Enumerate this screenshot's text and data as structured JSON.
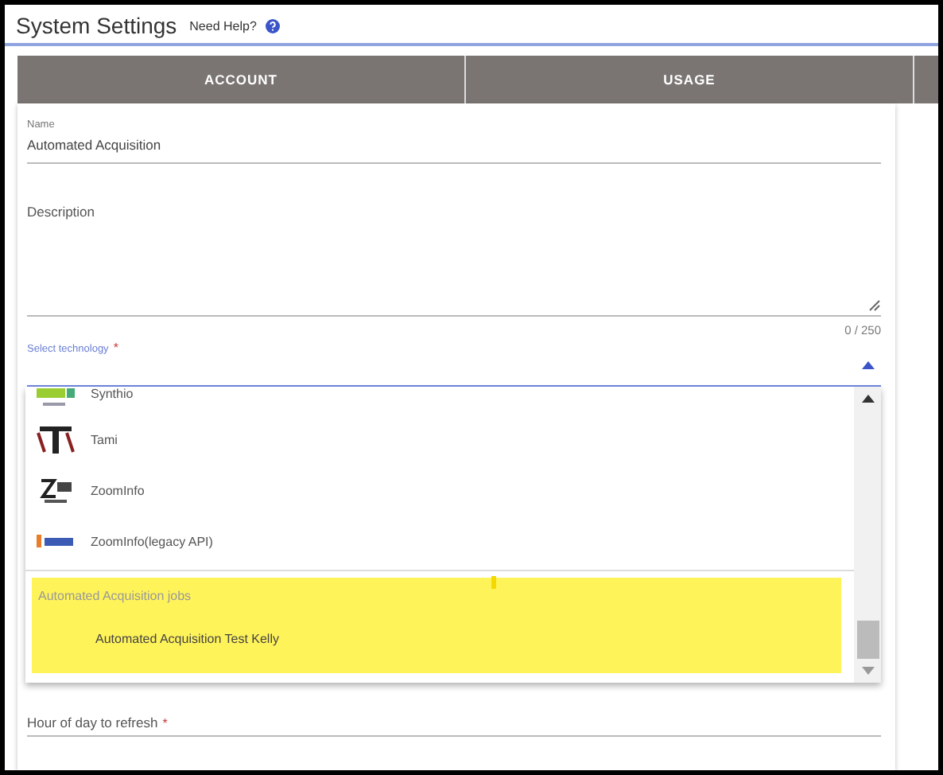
{
  "header": {
    "title": "System Settings",
    "help_link": "Need Help?"
  },
  "tabs": [
    {
      "label": "ACCOUNT",
      "selected": false
    },
    {
      "label": "USAGE",
      "selected": false
    }
  ],
  "form": {
    "name": {
      "label": "Name",
      "value": "Automated Acquisition"
    },
    "description": {
      "label": "Description",
      "counter": "0 / 250"
    },
    "technology": {
      "label": "Select technology",
      "required_mark": "*",
      "expanded": true,
      "options": [
        {
          "label": "Synthio",
          "kind": "synthio"
        },
        {
          "label": "Tami",
          "kind": "tami"
        },
        {
          "label": "ZoomInfo",
          "kind": "zoominfo"
        },
        {
          "label": "ZoomInfo(legacy API)",
          "kind": "zoominfolegacy"
        }
      ],
      "group": {
        "label": "Automated Acquisition jobs",
        "highlighted": true,
        "items": [
          "Automated Acquisition Test Kelly"
        ]
      }
    },
    "hour": {
      "label": "Hour of day to refresh",
      "required_mark": "*"
    }
  }
}
